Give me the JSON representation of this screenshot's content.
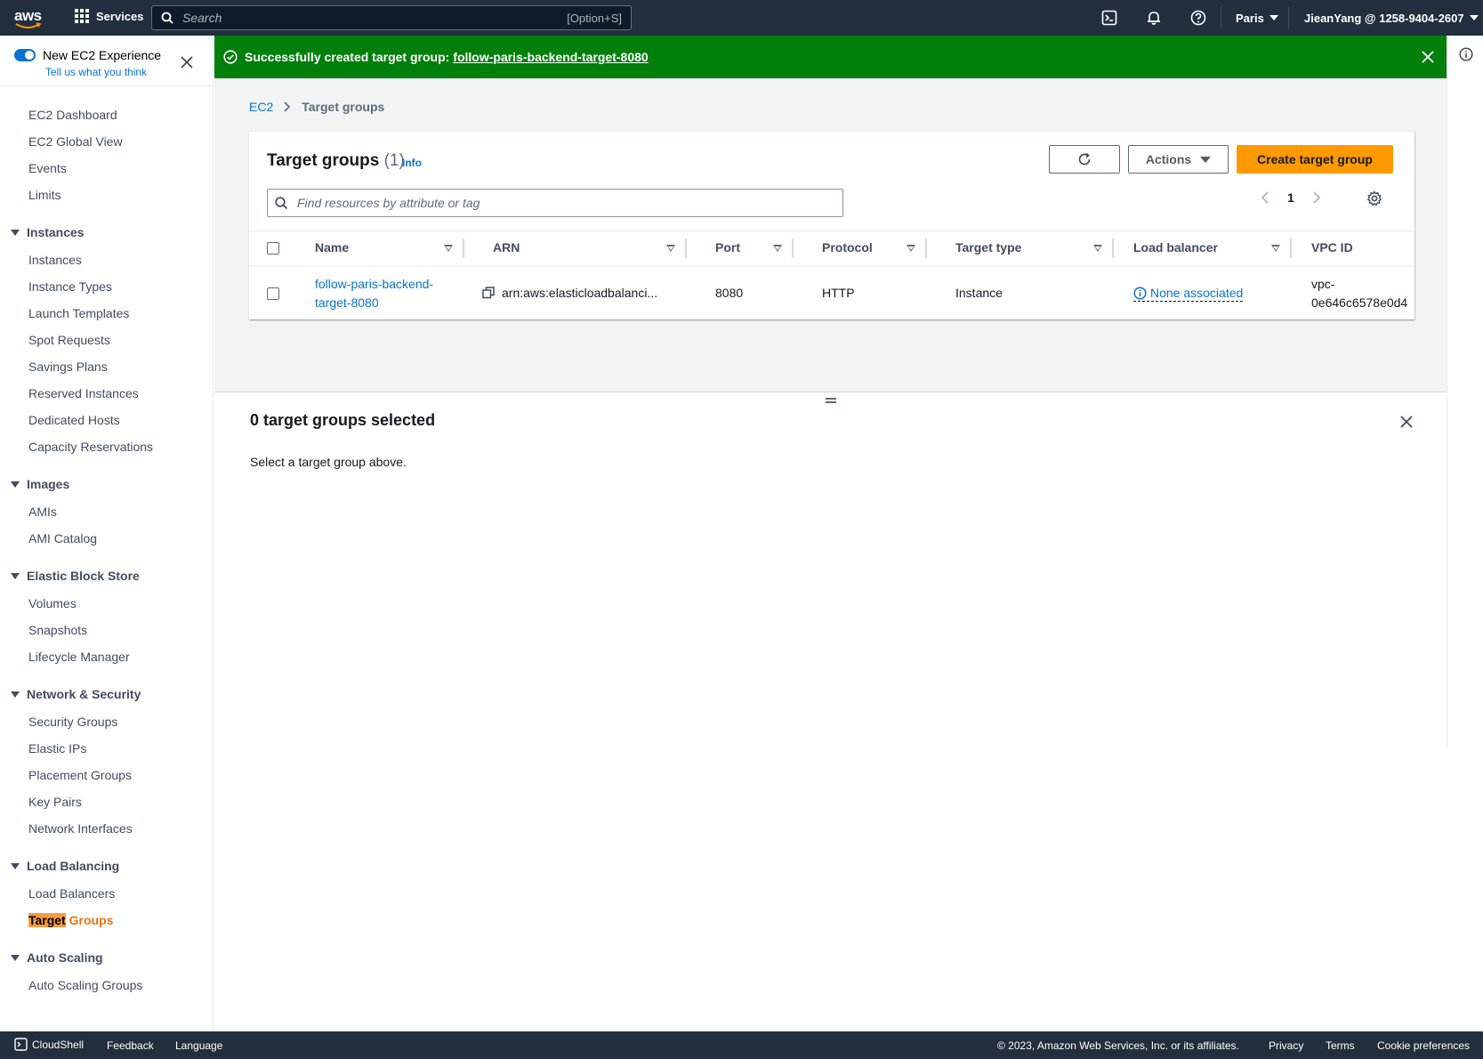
{
  "topnav": {
    "logo_text": "aws",
    "services_label": "Services",
    "search_placeholder": "Search",
    "search_shortcut": "[Option+S]",
    "region": "Paris",
    "account": "JieanYang @ 1258-9404-2607"
  },
  "sidebar": {
    "toggle_label": "New EC2 Experience",
    "tell_us": "Tell us what you think",
    "top_items": [
      "EC2 Dashboard",
      "EC2 Global View",
      "Events",
      "Limits"
    ],
    "sections": [
      {
        "title": "Instances",
        "items": [
          "Instances",
          "Instance Types",
          "Launch Templates",
          "Spot Requests",
          "Savings Plans",
          "Reserved Instances",
          "Dedicated Hosts",
          "Capacity Reservations"
        ]
      },
      {
        "title": "Images",
        "items": [
          "AMIs",
          "AMI Catalog"
        ]
      },
      {
        "title": "Elastic Block Store",
        "items": [
          "Volumes",
          "Snapshots",
          "Lifecycle Manager"
        ]
      },
      {
        "title": "Network & Security",
        "items": [
          "Security Groups",
          "Elastic IPs",
          "Placement Groups",
          "Key Pairs",
          "Network Interfaces"
        ]
      },
      {
        "title": "Load Balancing",
        "items": [
          "Load Balancers"
        ]
      },
      {
        "title": "Auto Scaling",
        "items": [
          "Auto Scaling Groups"
        ]
      }
    ],
    "active_item_highlight": "Target",
    "active_item_rest": " Groups"
  },
  "flash": {
    "message": "Successfully created target group:",
    "link": "follow-paris-backend-target-8080"
  },
  "breadcrumb": {
    "root": "EC2",
    "current": "Target groups"
  },
  "panel": {
    "title": "Target groups",
    "count": "(1)",
    "info": "Info",
    "actions_label": "Actions",
    "create_label": "Create target group",
    "filter_placeholder": "Find resources by attribute or tag",
    "page": "1"
  },
  "table": {
    "columns": [
      "Name",
      "ARN",
      "Port",
      "Protocol",
      "Target type",
      "Load balancer",
      "VPC ID"
    ],
    "rows": [
      {
        "name_line1": "follow-paris-backend-",
        "name_line2": "target-8080",
        "arn": "arn:aws:elasticloadbalanci...",
        "port": "8080",
        "protocol": "HTTP",
        "target_type": "Instance",
        "load_balancer": "None associated",
        "vpc_line1": "vpc-",
        "vpc_line2": "0e646c6578e0d4"
      }
    ]
  },
  "details": {
    "title": "0 target groups selected",
    "text": "Select a target group above."
  },
  "footer": {
    "cloudshell": "CloudShell",
    "feedback": "Feedback",
    "language": "Language",
    "copyright": "© 2023, Amazon Web Services, Inc. or its affiliates.",
    "privacy": "Privacy",
    "terms": "Terms",
    "cookies": "Cookie preferences"
  },
  "colors": {
    "nav_bg": "#232f3e",
    "success": "#037f0c",
    "link": "#0972d3",
    "primary": "#ff9900",
    "active": "#ec7211"
  }
}
